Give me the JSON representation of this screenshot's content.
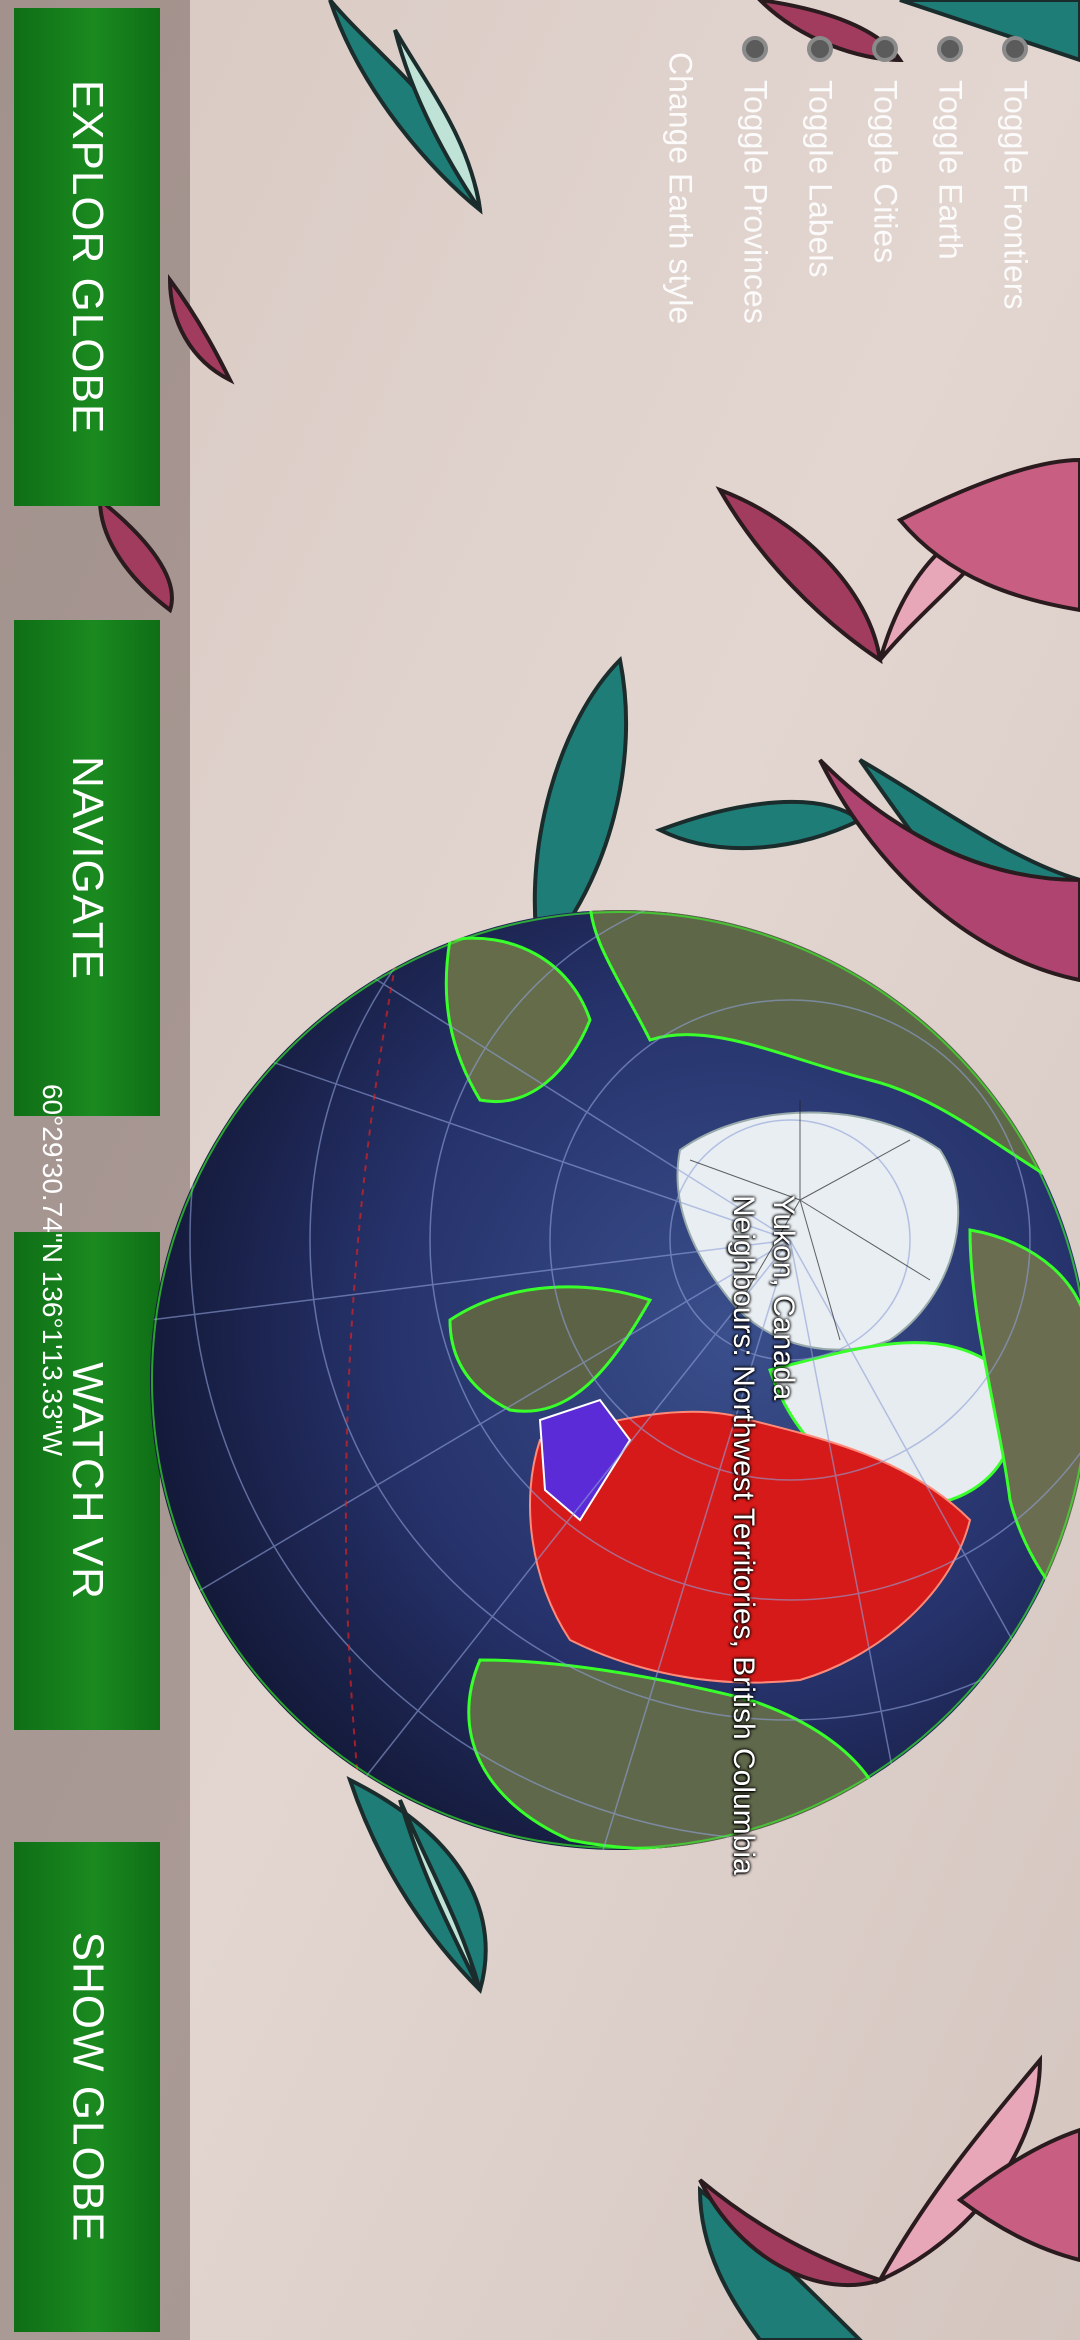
{
  "buttons": {
    "explore": "EXPLOR GLOBE",
    "navigate": "NAVIGATE",
    "watch_vr": "WATCH VR",
    "show_globe": "SHOW GLOBE"
  },
  "coordinates": "60°29'30.74\"N 136°1'13.33\"W",
  "menu": {
    "toggle_frontiers": "Toggle Frontiers",
    "toggle_earth": "Toggle Earth",
    "toggle_cities": "Toggle Cities",
    "toggle_labels": "Toggle Labels",
    "toggle_provinces": "Toggle Provinces",
    "change_earth_style": "Change Earth style"
  },
  "selection": {
    "line1": "Yukon, Canada",
    "line2": "Neighbours: Northwest Territories, British Columbia"
  },
  "colors": {
    "button_green": "#1a8a1f",
    "selected_province": "#5a2bd6",
    "neighbour_provinces": "#d61a1a",
    "frontier_lines": "#39ff2a"
  }
}
